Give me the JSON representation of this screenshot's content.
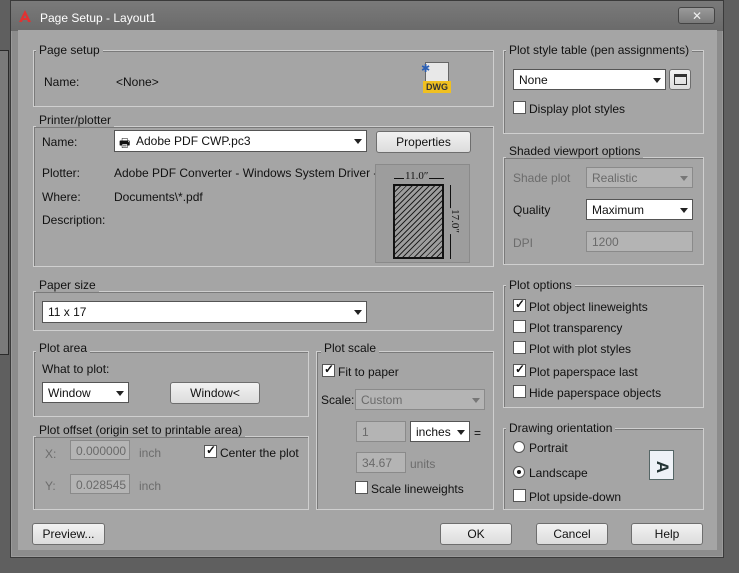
{
  "window": {
    "title": "Page Setup - Layout1",
    "app_icon": "autocad-logo"
  },
  "page_setup": {
    "group_title": "Page setup",
    "name_label": "Name:",
    "name_value": "<None>",
    "dwg_badge": "DWG"
  },
  "printer": {
    "group_title": "Printer/plotter",
    "name_label": "Name:",
    "printer_name": "Adobe PDF CWP.pc3",
    "properties_button": "Properties",
    "plotter_label": "Plotter:",
    "plotter_value": "Adobe PDF Converter - Windows System Driver - b...",
    "where_label": "Where:",
    "where_value": "Documents\\*.pdf",
    "description_label": "Description:",
    "preview_width": "11.0″",
    "preview_height": "17.0″"
  },
  "paper_size": {
    "group_title": "Paper size",
    "value": "11 x 17"
  },
  "plot_area": {
    "group_title": "Plot area",
    "what_label": "What to plot:",
    "what_value": "Window",
    "window_button": "Window<"
  },
  "plot_offset": {
    "group_title": "Plot offset (origin set to printable area)",
    "x_label": "X:",
    "x_value": "0.000000",
    "x_unit": "inch",
    "y_label": "Y:",
    "y_value": "0.028545",
    "y_unit": "inch",
    "center_label": "Center the plot",
    "center_checked": true
  },
  "plot_scale": {
    "group_title": "Plot scale",
    "fit_label": "Fit to paper",
    "fit_checked": true,
    "scale_label": "Scale:",
    "scale_value": "Custom",
    "num_value": "1",
    "unit_value": "inches",
    "equals": "=",
    "den_value": "34.67",
    "den_unit": "units",
    "lineweights_label": "Scale lineweights",
    "lineweights_checked": false
  },
  "plot_style": {
    "group_title": "Plot style table (pen assignments)",
    "value": "None",
    "display_label": "Display plot styles",
    "display_checked": false
  },
  "shaded": {
    "group_title": "Shaded viewport options",
    "shade_label": "Shade plot",
    "shade_value": "Realistic",
    "quality_label": "Quality",
    "quality_value": "Maximum",
    "dpi_label": "DPI",
    "dpi_value": "1200"
  },
  "plot_options": {
    "group_title": "Plot options",
    "items": [
      {
        "label": "Plot object lineweights",
        "checked": true
      },
      {
        "label": "Plot transparency",
        "checked": false
      },
      {
        "label": "Plot with plot styles",
        "checked": false
      },
      {
        "label": "Plot paperspace last",
        "checked": true
      },
      {
        "label": "Hide paperspace objects",
        "checked": false
      }
    ]
  },
  "orientation": {
    "group_title": "Drawing orientation",
    "portrait": "Portrait",
    "landscape": "Landscape",
    "upside_down": "Plot upside-down",
    "selected": "Landscape",
    "orientation_glyph": "A"
  },
  "buttons": {
    "preview": "Preview...",
    "ok": "OK",
    "cancel": "Cancel",
    "help": "Help"
  }
}
